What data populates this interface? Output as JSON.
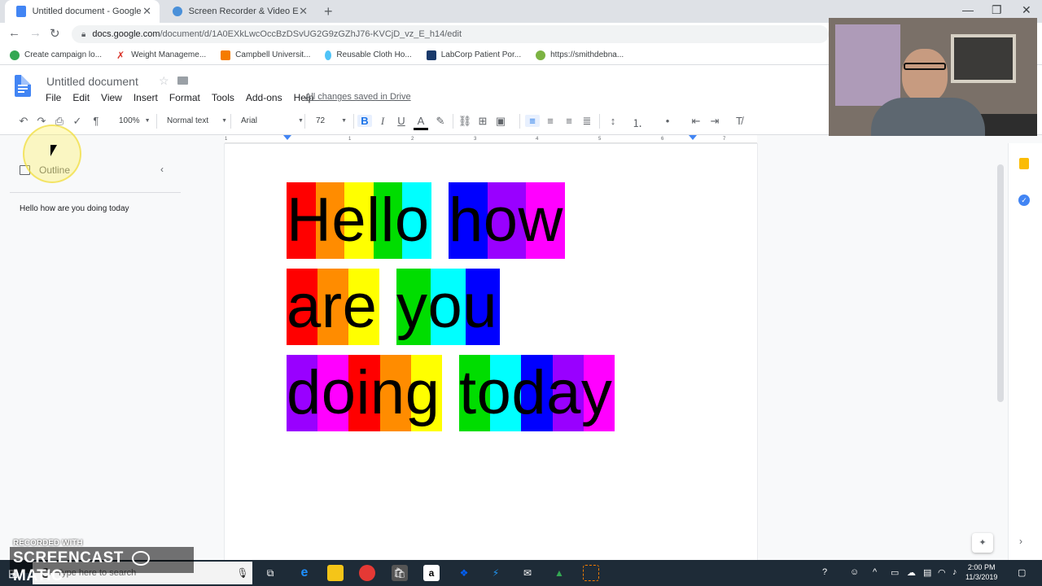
{
  "browser": {
    "tabs": [
      {
        "title": "Untitled document - Google Docs",
        "active": true,
        "favicon_color": "#4285f4"
      },
      {
        "title": "Screen Recorder & Video Editor",
        "active": false,
        "favicon_color": "#4a90d9"
      }
    ],
    "new_tab": "+",
    "url_host": "docs.google.com",
    "url_path": "/document/d/1A0EXkLwcOccBzDSvUG2G9zGZhJ76-KVCjD_vz_E_h14/edit",
    "bookmarks": [
      {
        "label": "Create campaign lo...",
        "color": "#34a853"
      },
      {
        "label": "Weight Manageme...",
        "color": "#d93025"
      },
      {
        "label": "Campbell Universit...",
        "color": "#f57c00"
      },
      {
        "label": "Reusable Cloth Ho...",
        "color": "#4fc3f7"
      },
      {
        "label": "LabCorp Patient Por...",
        "color": "#1a3a6b"
      },
      {
        "label": "https://smithdebna...",
        "color": "#7cb342"
      }
    ]
  },
  "docs": {
    "title": "Untitled document",
    "menu": [
      "File",
      "Edit",
      "View",
      "Insert",
      "Format",
      "Tools",
      "Add-ons",
      "Help"
    ],
    "saved_status": "All changes saved in Drive",
    "toolbar": {
      "zoom": "100%",
      "style": "Normal text",
      "font": "Arial",
      "size": "72"
    },
    "ruler_marks": [
      "1",
      "1",
      "2",
      "3",
      "4",
      "5",
      "6",
      "7"
    ],
    "outline": {
      "title": "Outline",
      "items": [
        "Hello how are you doing today"
      ]
    },
    "document": {
      "lines": [
        [
          {
            "text": "Hello",
            "stripes": [
              "#ff0000",
              "#ff8c00",
              "#ffff00",
              "#00dd00",
              "#00ffff"
            ]
          },
          {
            "text": "how",
            "stripes": [
              "#0000ff",
              "#9900ff",
              "#ff00ff"
            ]
          }
        ],
        [
          {
            "text": "are",
            "stripes": [
              "#ff0000",
              "#ff8c00",
              "#ffff00"
            ]
          },
          {
            "text": "you",
            "stripes": [
              "#00dd00",
              "#00ffff",
              "#0000ff"
            ]
          }
        ],
        [
          {
            "text": "doing",
            "stripes": [
              "#9900ff",
              "#ff00ff",
              "#ff0000",
              "#ff8c00",
              "#ffff00"
            ]
          },
          {
            "text": "today",
            "stripes": [
              "#00dd00",
              "#00ffff",
              "#0000ff",
              "#9900ff",
              "#ff00ff"
            ]
          }
        ]
      ]
    }
  },
  "watermark": {
    "small": "RECORDED WITH",
    "big": "SCREENCAST",
    "big_suffix": "MATIC"
  },
  "taskbar": {
    "search_placeholder": "Type here to search",
    "time": "2:00 PM",
    "date": "11/3/2019"
  }
}
